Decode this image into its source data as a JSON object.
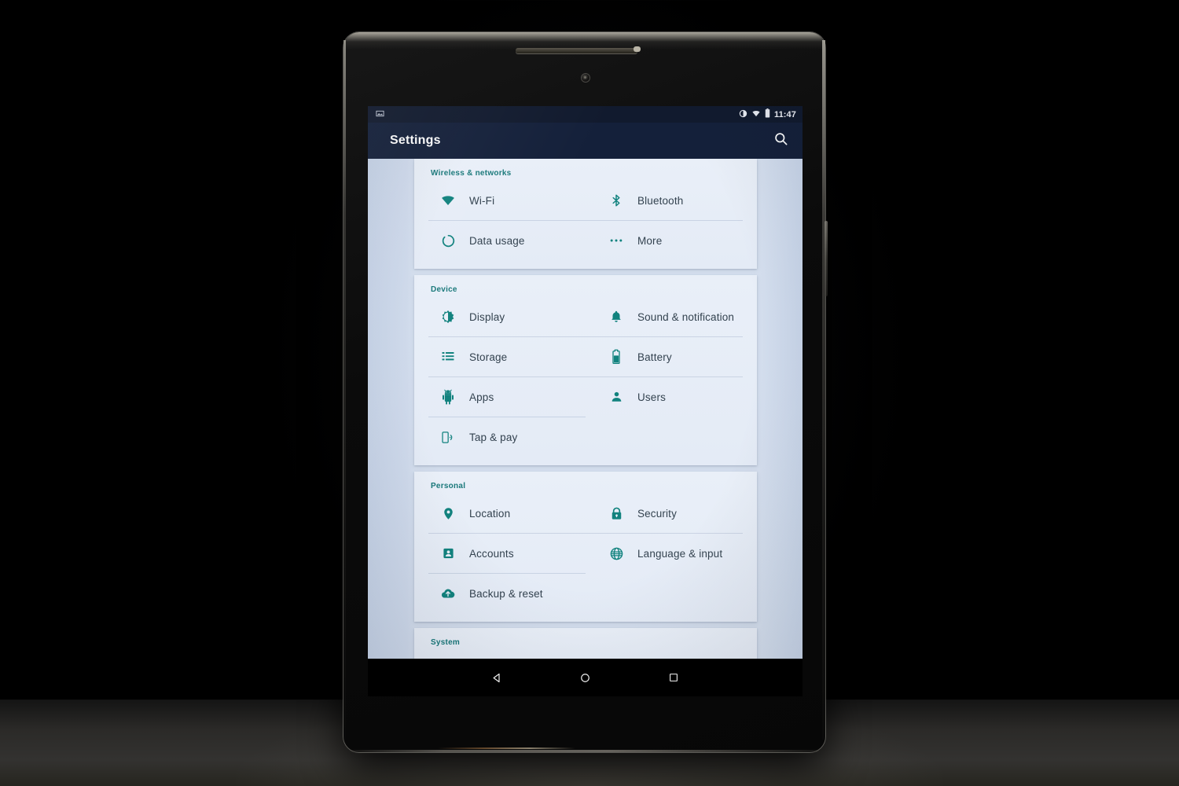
{
  "device": {
    "name": "android-tablet",
    "navbar": {
      "back_label": "Back",
      "home_label": "Home",
      "recents_label": "Recent apps"
    }
  },
  "statusbar": {
    "notification_icon": "screenshot-icon",
    "icons": [
      "do-not-disturb-icon",
      "wifi-icon",
      "battery-icon"
    ],
    "time": "11:47"
  },
  "appbar": {
    "title": "Settings",
    "search_label": "Search"
  },
  "colors": {
    "accent_teal": "#11827e",
    "section_header": "#19787a",
    "appbar_bg": "#14203a",
    "statusbar_bg": "#111a2e",
    "card_bg": "#e9eff8",
    "page_bg": "#d6e0ef",
    "label_text": "#33424f"
  },
  "sections": [
    {
      "id": "wireless-networks",
      "title": "Wireless & networks",
      "items": [
        {
          "label": "Wi-Fi",
          "icon": "wifi-icon",
          "column": "left"
        },
        {
          "label": "Bluetooth",
          "icon": "bluetooth-icon",
          "column": "right"
        },
        {
          "label": "Data usage",
          "icon": "data-usage-icon",
          "column": "left"
        },
        {
          "label": "More",
          "icon": "more-icon",
          "column": "right"
        }
      ]
    },
    {
      "id": "device",
      "title": "Device",
      "items": [
        {
          "label": "Display",
          "icon": "brightness-icon",
          "column": "left"
        },
        {
          "label": "Sound & notification",
          "icon": "bell-icon",
          "column": "right"
        },
        {
          "label": "Storage",
          "icon": "storage-icon",
          "column": "left"
        },
        {
          "label": "Battery",
          "icon": "battery-icon",
          "column": "right"
        },
        {
          "label": "Apps",
          "icon": "android-icon",
          "column": "left"
        },
        {
          "label": "Users",
          "icon": "person-icon",
          "column": "right"
        },
        {
          "label": "Tap & pay",
          "icon": "tap-and-pay-icon",
          "column": "left"
        }
      ]
    },
    {
      "id": "personal",
      "title": "Personal",
      "items": [
        {
          "label": "Location",
          "icon": "location-pin-icon",
          "column": "left"
        },
        {
          "label": "Security",
          "icon": "lock-icon",
          "column": "right"
        },
        {
          "label": "Accounts",
          "icon": "account-card-icon",
          "column": "left"
        },
        {
          "label": "Language & input",
          "icon": "globe-icon",
          "column": "right"
        },
        {
          "label": "Backup & reset",
          "icon": "cloud-upload-icon",
          "column": "left"
        }
      ]
    },
    {
      "id": "system",
      "title": "System",
      "items": []
    }
  ]
}
